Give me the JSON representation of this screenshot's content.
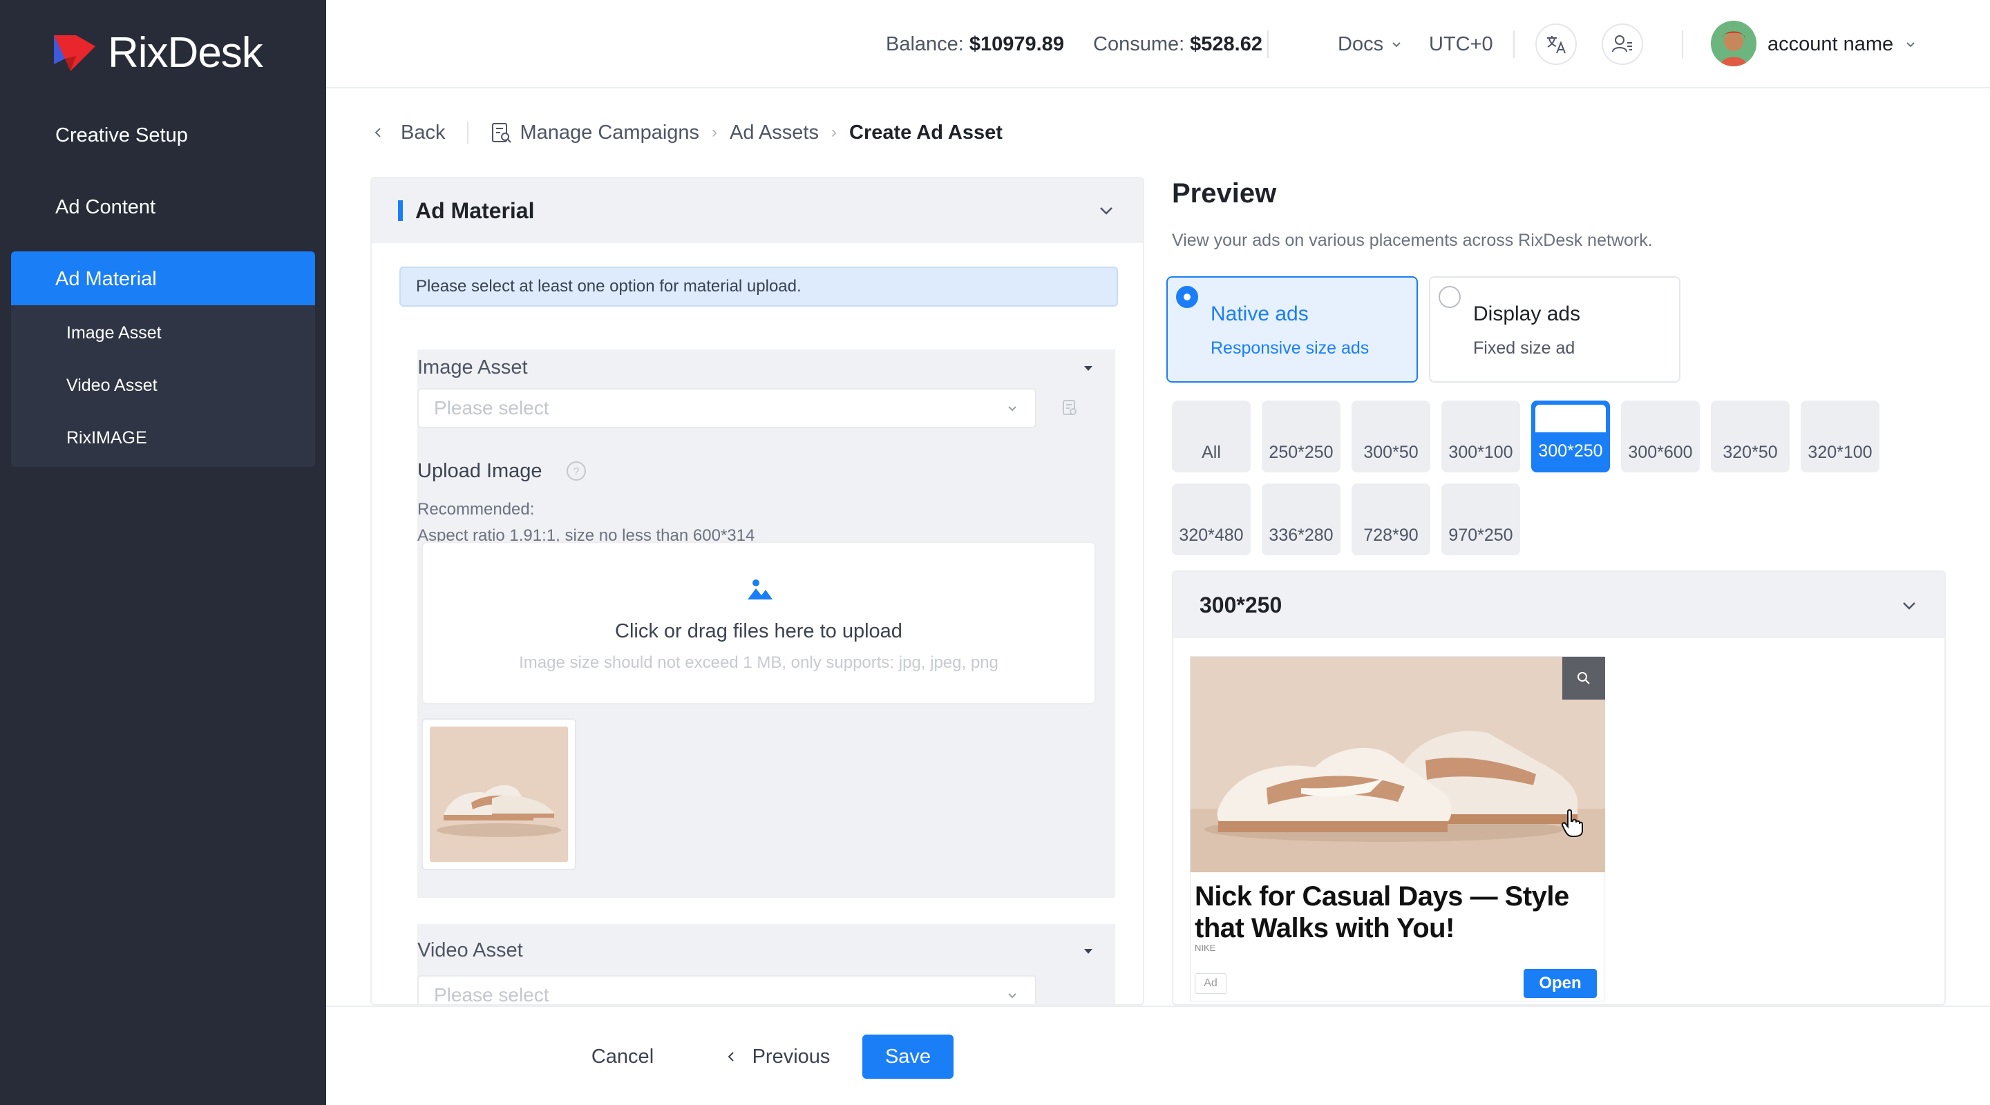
{
  "app": {
    "name": "RixDesk"
  },
  "sidebar": {
    "items": [
      {
        "label": "Creative Setup"
      },
      {
        "label": "Ad Content"
      },
      {
        "label": "Ad Material"
      }
    ],
    "subitems": [
      {
        "label": "Image Asset"
      },
      {
        "label": "Video Asset"
      },
      {
        "label": "RixIMAGE"
      }
    ]
  },
  "topbar": {
    "balance_label": "Balance:",
    "balance_value": "$10979.89",
    "consume_label": "Consume:",
    "consume_value": "$528.62",
    "docs_label": "Docs",
    "timezone": "UTC+0",
    "account_name": "account name"
  },
  "breadcrumb": {
    "back": "Back",
    "items": [
      "Manage Campaigns",
      "Ad Assets",
      "Create Ad Asset"
    ]
  },
  "material": {
    "title": "Ad Material",
    "notice": "Please select at least one option for material upload.",
    "image_asset": {
      "title": "Image Asset",
      "placeholder": "Please select",
      "upload_label": "Upload Image",
      "recommended": "Recommended:",
      "aspect": "Aspect ratio 1.91:1, size no less than 600*314",
      "upload_text": "Click or drag files here to upload",
      "upload_hint": "Image size should not exceed 1 MB, only supports: jpg, jpeg, png"
    },
    "video_asset": {
      "title": "Video Asset",
      "placeholder": "Please select"
    }
  },
  "preview": {
    "title": "Preview",
    "description": "View your ads on various placements across RixDesk network.",
    "ad_types": [
      {
        "name": "Native ads",
        "sub": "Responsive size ads",
        "selected": true
      },
      {
        "name": "Display ads",
        "sub": "Fixed size ad",
        "selected": false
      }
    ],
    "sizes": [
      "All",
      "250*250",
      "300*50",
      "300*100",
      "300*250",
      "300*600",
      "320*50",
      "320*100",
      "320*480",
      "336*280",
      "728*90",
      "970*250"
    ],
    "selected_size": "300*250",
    "section_title": "300*250",
    "ad": {
      "headline": "Nick for Casual Days — Style that Walks with You!",
      "brand": "NIKE",
      "tag": "Ad",
      "cta": "Open"
    }
  },
  "footer": {
    "cancel": "Cancel",
    "previous": "Previous",
    "save": "Save"
  },
  "colors": {
    "accent": "#1a7ef7",
    "sidebar_bg": "#272c38"
  }
}
